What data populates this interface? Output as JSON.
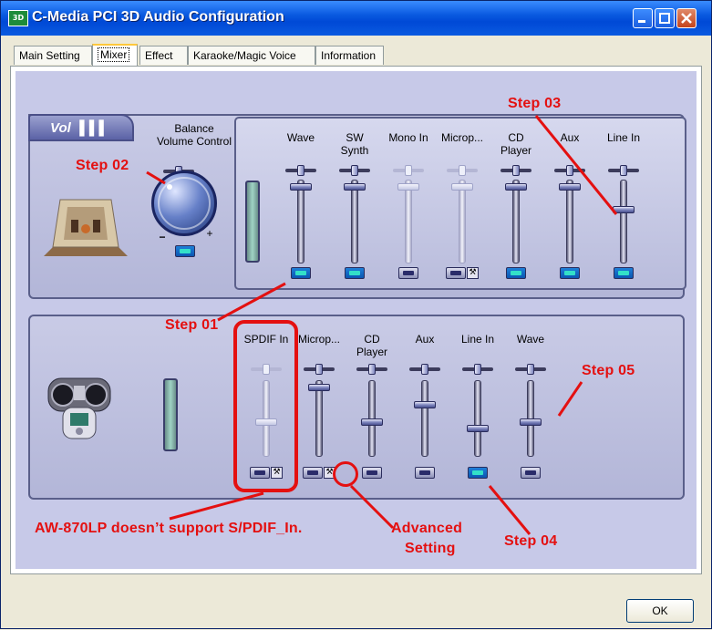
{
  "window": {
    "title": "C-Media PCI 3D Audio Configuration",
    "ok_label": "OK"
  },
  "tabs": [
    {
      "label": "Main Setting",
      "active": false
    },
    {
      "label": "Mixer",
      "active": true
    },
    {
      "label": "Effect",
      "active": false
    },
    {
      "label": "Karaoke/Magic Voice",
      "active": false
    },
    {
      "label": "Information",
      "active": false
    }
  ],
  "playback": {
    "badge": "Vol",
    "balance_label": "Balance\nVolume Control",
    "channels": [
      {
        "label": "Wave",
        "enabled": true,
        "level": 0.95,
        "mute_active": true
      },
      {
        "label": "SW\nSynth",
        "enabled": true,
        "level": 0.95,
        "mute_active": true
      },
      {
        "label": "Mono In",
        "enabled": false,
        "level": 0.95,
        "mute_active": false
      },
      {
        "label": "Microp...",
        "enabled": false,
        "level": 0.95,
        "mute_active": false,
        "advanced": true
      },
      {
        "label": "CD\nPlayer",
        "enabled": true,
        "level": 0.95,
        "mute_active": true
      },
      {
        "label": "Aux",
        "enabled": true,
        "level": 0.95,
        "mute_active": true
      },
      {
        "label": "Line In",
        "enabled": true,
        "level": 0.65,
        "mute_active": true
      }
    ]
  },
  "recording": {
    "channels": [
      {
        "label": "SPDIF In",
        "enabled": false,
        "level": 0.45,
        "mute_active": false,
        "advanced": true
      },
      {
        "label": "Microp...",
        "enabled": true,
        "level": 0.95,
        "mute_active": false,
        "advanced": true
      },
      {
        "label": "CD\nPlayer",
        "enabled": true,
        "level": 0.45,
        "mute_active": false
      },
      {
        "label": "Aux",
        "enabled": true,
        "level": 0.7,
        "mute_active": false
      },
      {
        "label": "Line In",
        "enabled": true,
        "level": 0.35,
        "mute_active": true
      },
      {
        "label": "Wave",
        "enabled": true,
        "level": 0.45,
        "mute_active": false
      }
    ]
  },
  "annotations": {
    "step01": "Step 01",
    "step02": "Step 02",
    "step03": "Step 03",
    "step04": "Step 04",
    "step05": "Step 05",
    "spdif_note": "AW-870LP doesn’t support S/PDIF_In.",
    "advanced_line1": "Advanced",
    "advanced_line2": "Setting"
  },
  "colors": {
    "annotation": "#e41010",
    "titlebar": "#0a5ae0",
    "panel": "#c7c9e8"
  },
  "icons": {
    "balance_minus": "−",
    "balance_plus": "+",
    "advanced": "wrench-icon"
  }
}
